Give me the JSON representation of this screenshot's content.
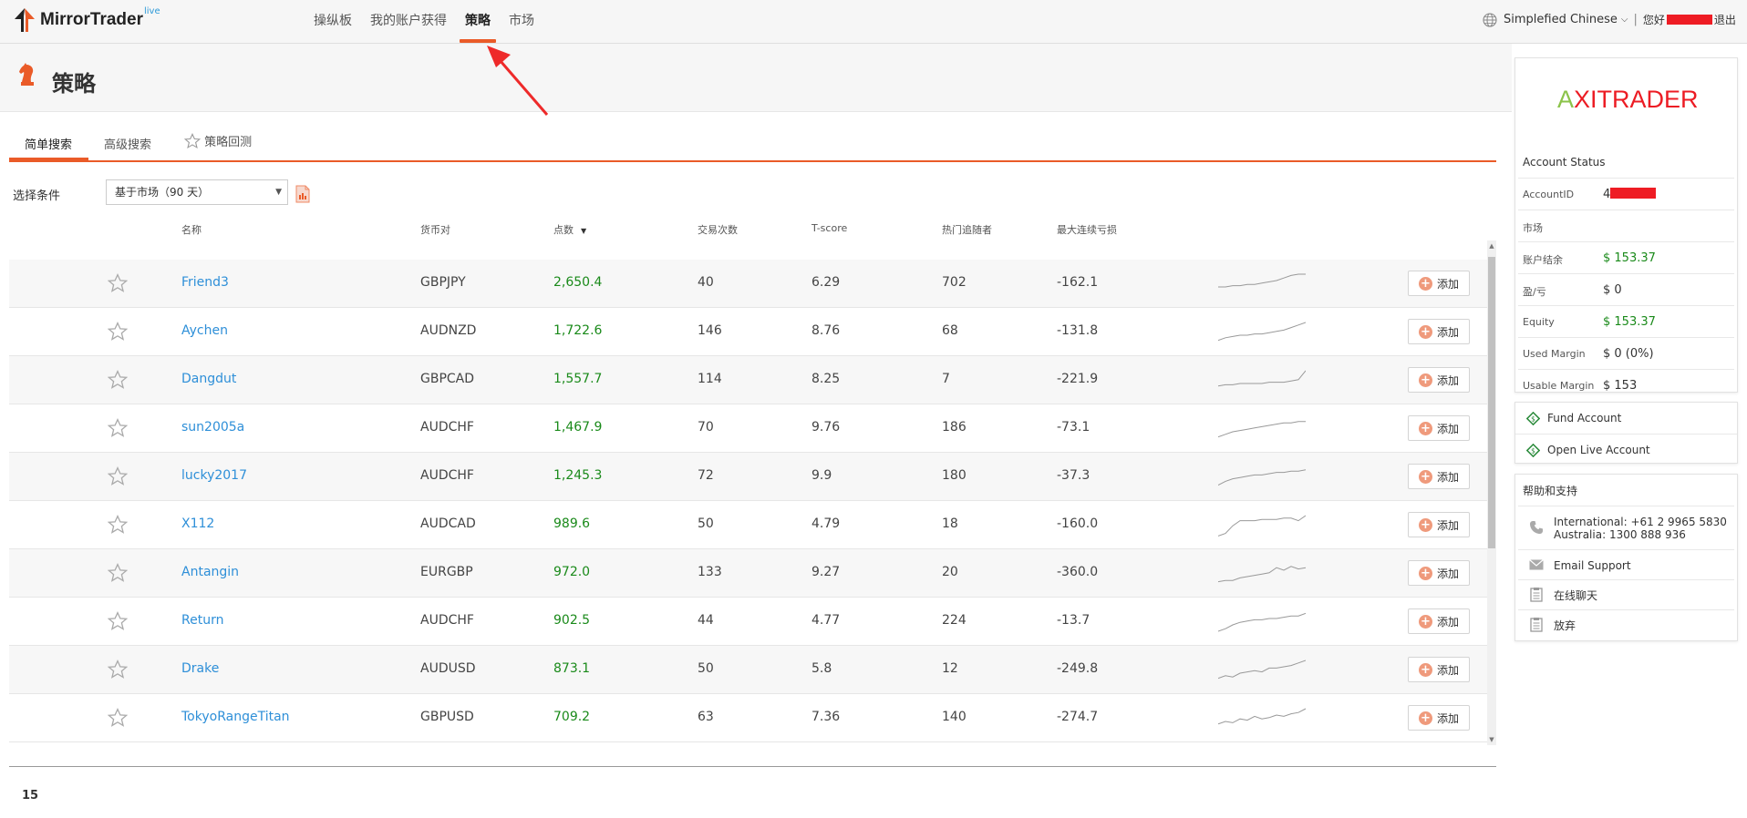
{
  "app": {
    "name": "MirrorTrader",
    "badge": "live"
  },
  "nav": {
    "items": [
      {
        "label": "操纵板",
        "active": false
      },
      {
        "label": "我的账户获得",
        "active": false
      },
      {
        "label": "策略",
        "active": true
      },
      {
        "label": "市场",
        "active": false
      }
    ]
  },
  "header_right": {
    "language": "Simplefied Chinese",
    "greeting": "您好",
    "logout": "退出"
  },
  "page": {
    "title": "策略"
  },
  "tabs": [
    {
      "label": "简单搜索",
      "active": true
    },
    {
      "label": "高级搜索",
      "active": false
    },
    {
      "label": "策略回测",
      "active": false
    }
  ],
  "filter": {
    "label": "选择条件",
    "selected": "基于市场（90 天）"
  },
  "table": {
    "columns": [
      "名称",
      "货币对",
      "点数",
      "交易次数",
      "T-score",
      "热门追随者",
      "最大连续亏损"
    ],
    "sort_column": "点数",
    "add_label": "添加",
    "rows": [
      {
        "name": "Friend3",
        "pair": "GBPJPY",
        "pips": "2,650.4",
        "trades": "40",
        "tscore": "6.29",
        "followers": "702",
        "maxloss": "-162.1",
        "spark": [
          10,
          10,
          9,
          9,
          8,
          8,
          7,
          6,
          5,
          3,
          1,
          0,
          0
        ]
      },
      {
        "name": "Aychen",
        "pair": "AUDNZD",
        "pips": "1,722.6",
        "trades": "146",
        "tscore": "8.76",
        "followers": "68",
        "maxloss": "-131.8",
        "spark": [
          14,
          12,
          11,
          10,
          10,
          9,
          9,
          8,
          7,
          6,
          4,
          2,
          0
        ]
      },
      {
        "name": "Dangdut",
        "pair": "GBPCAD",
        "pips": "1,557.7",
        "trades": "114",
        "tscore": "8.25",
        "followers": "7",
        "maxloss": "-221.9",
        "spark": [
          12,
          11,
          11,
          10,
          10,
          10,
          10,
          9,
          9,
          9,
          8,
          7,
          0
        ]
      },
      {
        "name": "sun2005a",
        "pair": "AUDCHF",
        "pips": "1,467.9",
        "trades": "70",
        "tscore": "9.76",
        "followers": "186",
        "maxloss": "-73.1",
        "spark": [
          14,
          12,
          10,
          9,
          8,
          7,
          6,
          5,
          4,
          3,
          3,
          2,
          2
        ]
      },
      {
        "name": "lucky2017",
        "pair": "AUDCHF",
        "pips": "1,245.3",
        "trades": "72",
        "tscore": "9.9",
        "followers": "180",
        "maxloss": "-37.3",
        "spark": [
          14,
          11,
          9,
          8,
          7,
          6,
          6,
          5,
          4,
          4,
          3,
          3,
          2
        ]
      },
      {
        "name": "X112",
        "pair": "AUDCAD",
        "pips": "989.6",
        "trades": "50",
        "tscore": "4.79",
        "followers": "18",
        "maxloss": "-160.0",
        "spark": [
          16,
          14,
          8,
          4,
          4,
          4,
          3,
          3,
          3,
          2,
          2,
          4,
          0
        ]
      },
      {
        "name": "Antangin",
        "pair": "EURGBP",
        "pips": "972.0",
        "trades": "133",
        "tscore": "9.27",
        "followers": "20",
        "maxloss": "-360.0",
        "spark": [
          14,
          13,
          13,
          11,
          10,
          9,
          8,
          7,
          3,
          5,
          2,
          4,
          3
        ]
      },
      {
        "name": "Return",
        "pair": "AUDCHF",
        "pips": "902.5",
        "trades": "44",
        "tscore": "4.77",
        "followers": "224",
        "maxloss": "-13.7",
        "spark": [
          15,
          13,
          10,
          8,
          7,
          6,
          6,
          5,
          5,
          4,
          3,
          3,
          1
        ]
      },
      {
        "name": "Drake",
        "pair": "AUDUSD",
        "pips": "873.1",
        "trades": "50",
        "tscore": "5.8",
        "followers": "12",
        "maxloss": "-249.8",
        "spark": [
          14,
          12,
          13,
          10,
          9,
          8,
          9,
          6,
          6,
          5,
          4,
          2,
          0
        ]
      },
      {
        "name": "TokyoRangeTitan",
        "pair": "GBPUSD",
        "pips": "709.2",
        "trades": "63",
        "tscore": "7.36",
        "followers": "140",
        "maxloss": "-274.7",
        "spark": [
          12,
          10,
          11,
          8,
          9,
          6,
          8,
          7,
          5,
          6,
          4,
          3,
          0
        ]
      }
    ]
  },
  "pagination": {
    "count": "15"
  },
  "account": {
    "brand": {
      "a": "A",
      "x": "X",
      "rest": "ITRADER"
    },
    "title": "Account Status",
    "rows": [
      {
        "label": "AccountID",
        "value": "4"
      },
      {
        "label": "市场",
        "value": ""
      },
      {
        "label": "账户结余",
        "value": "$ 153.37",
        "green": true
      },
      {
        "label": "盈/亏",
        "value": "$ 0"
      },
      {
        "label": "Equity",
        "value": "$ 153.37",
        "green": true
      },
      {
        "label": "Used Margin",
        "value": "$ 0 (0%)"
      },
      {
        "label": "Usable Margin",
        "value": "$ 153"
      }
    ]
  },
  "account_links": [
    {
      "label": "Fund Account"
    },
    {
      "label": "Open Live Account"
    }
  ],
  "support": {
    "title": "帮助和支持",
    "phone_intl": "International: +61 2 9965 5830",
    "phone_au": "Australia: 1300 888 936",
    "email": "Email Support",
    "chat": "在线聊天",
    "abandon": "放弃"
  },
  "colors": {
    "accent": "#ea5b28",
    "link": "#2e8fd8",
    "positive": "#1a8a1a",
    "brand_red": "#ec1c24",
    "brand_green": "#8bc34a"
  }
}
